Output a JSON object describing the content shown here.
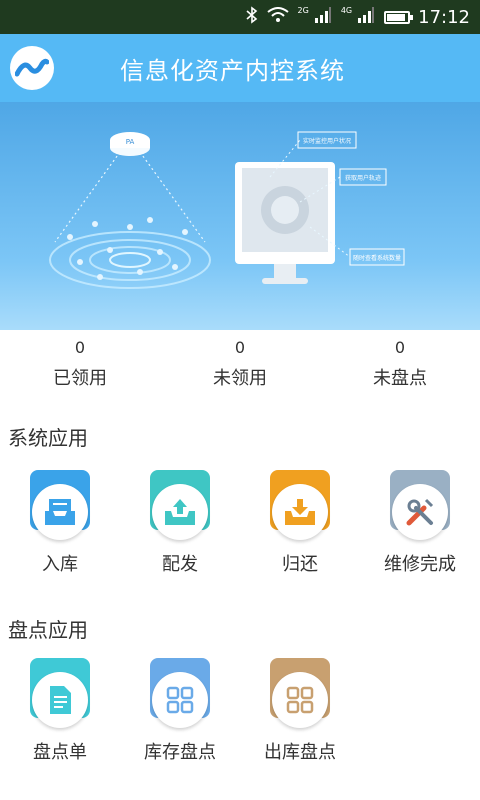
{
  "status_bar": {
    "time": "17:12",
    "network_2g": "2G",
    "network_4g": "4G",
    "icons": [
      "bluetooth-icon",
      "wifi-icon",
      "signal-icon",
      "signal-icon",
      "battery-icon"
    ]
  },
  "header": {
    "title": "信息化资产内控系统",
    "logo": "app-logo-icon"
  },
  "banner": {
    "sign_top": "PA",
    "callout_1": "实时监控用户状况",
    "callout_2": "获取用户轨迹",
    "callout_3": "随时查看系统数量"
  },
  "stats": [
    {
      "value": "0",
      "label": "已领用"
    },
    {
      "value": "0",
      "label": "未领用"
    },
    {
      "value": "0",
      "label": "未盘点"
    }
  ],
  "system_apps": {
    "title": "系统应用",
    "items": [
      {
        "label": "入库",
        "icon": "inbox-tray-icon",
        "color": "#3aa3e9"
      },
      {
        "label": "配发",
        "icon": "outbox-tray-icon",
        "color": "#3fc6c4"
      },
      {
        "label": "归还",
        "icon": "return-download-icon",
        "color": "#f0a020"
      },
      {
        "label": "维修完成",
        "icon": "wrench-screwdriver-icon",
        "color": "#9ab0c4"
      }
    ]
  },
  "inventory_apps": {
    "title": "盘点应用",
    "items": [
      {
        "label": "盘点单",
        "icon": "document-icon",
        "color": "#3fc9d6"
      },
      {
        "label": "库存盘点",
        "icon": "grid-icon",
        "color": "#6aaae8"
      },
      {
        "label": "出库盘点",
        "icon": "grid-icon",
        "color": "#c8a070"
      }
    ]
  }
}
